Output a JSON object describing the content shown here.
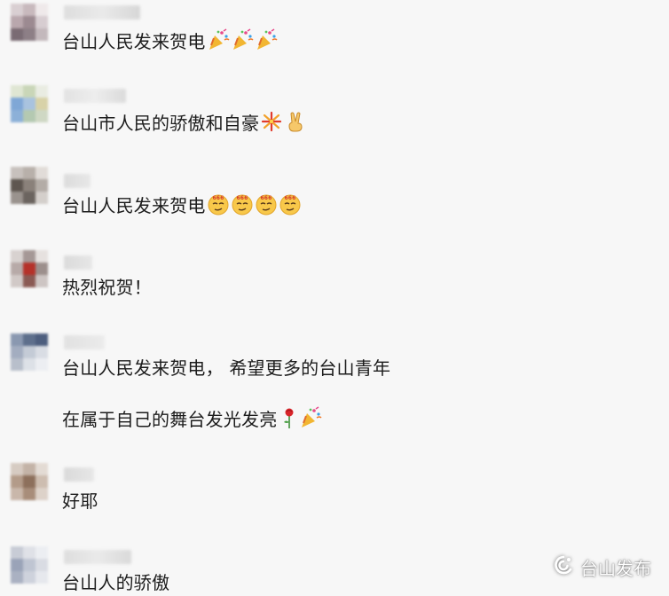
{
  "comments": [
    {
      "text": "台山人民发来贺电",
      "emojis": [
        "party-popper",
        "party-popper",
        "party-popper"
      ]
    },
    {
      "text": "台山市人民的骄傲和自豪",
      "emojis": [
        "fireworks",
        "victory-hand"
      ]
    },
    {
      "text": "台山人民发来贺电",
      "emojis": [
        "666-face",
        "666-face",
        "666-face",
        "666-face"
      ]
    },
    {
      "text": "热烈祝贺！",
      "emojis": []
    },
    {
      "text": "台山人民发来贺电，  希望更多的台山青年",
      "text2": "在属于自己的舞台发光发亮",
      "emojis2": [
        "rose",
        "party-popper"
      ]
    },
    {
      "text": "好耶",
      "emojis": []
    },
    {
      "text": "台山人的骄傲",
      "emojis": []
    }
  ],
  "watermark": {
    "label": "台山发布",
    "icon": "wechat-official-account-icon"
  },
  "colors": {
    "background": "#f7f7f7",
    "text": "#1c1c1c"
  }
}
